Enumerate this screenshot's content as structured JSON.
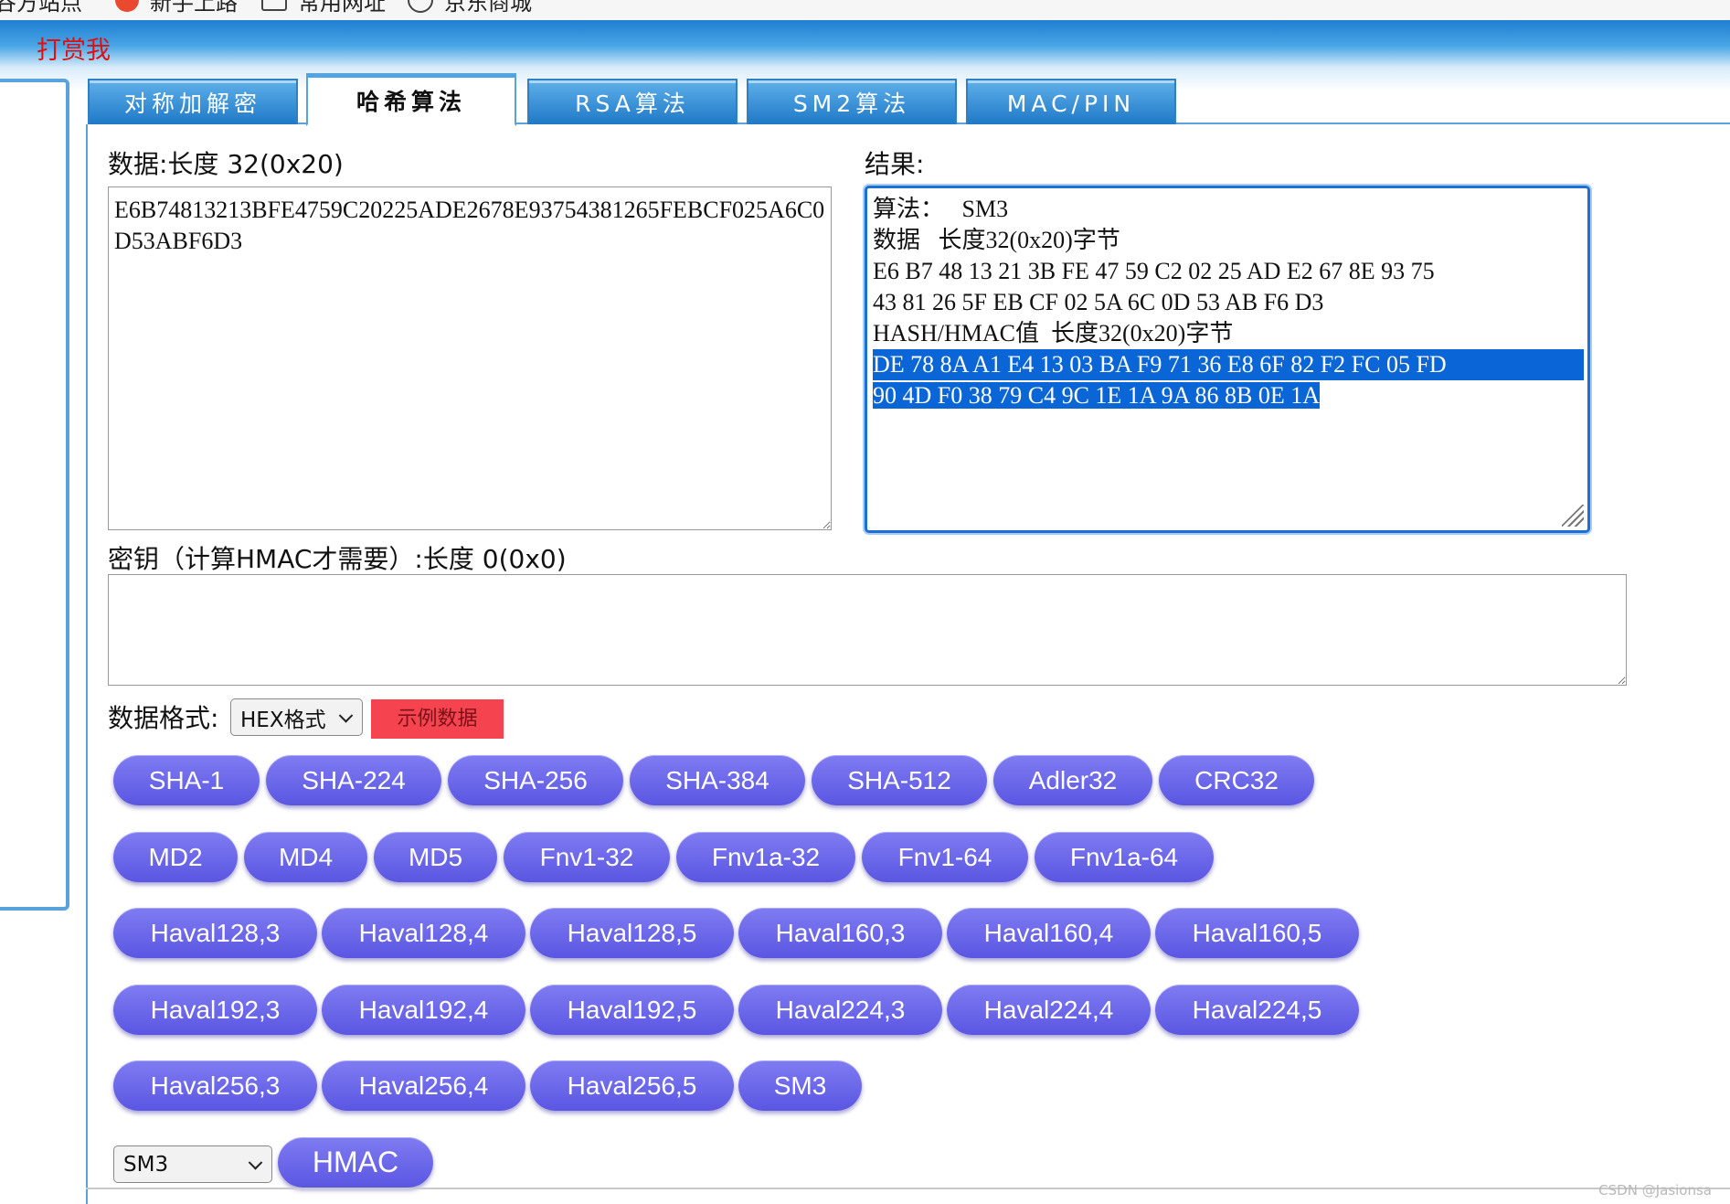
{
  "bookmarks": [
    {
      "label": "谷方站点",
      "icon": "none"
    },
    {
      "label": "新手上路",
      "icon": "firefox-icon"
    },
    {
      "label": "常用网址",
      "icon": "folder-icon"
    },
    {
      "label": "京东商城",
      "icon": "globe-icon"
    }
  ],
  "header": {
    "donate_link": "打赏我"
  },
  "tabs": [
    {
      "label": "对称加解密",
      "active": false
    },
    {
      "label": "哈希算法",
      "active": true
    },
    {
      "label": "RSA算法",
      "active": false
    },
    {
      "label": "SM2算法",
      "active": false
    },
    {
      "label": "MAC/PIN",
      "active": false
    }
  ],
  "data_section": {
    "label": "数据:长度 32(0x20)",
    "value": "E6B74813213BFE4759C20225ADE2678E93754381265FEBCF025A6C0D53ABF6D3"
  },
  "result_section": {
    "label": "结果:",
    "lines": [
      "算法：   SM3",
      "数据   长度32(0x20)字节",
      "E6 B7 48 13 21 3B FE 47 59 C2 02 25 AD E2 67 8E 93 75",
      "43 81 26 5F EB CF 02 5A 6C 0D 53 AB F6 D3",
      "HASH/HMAC值  长度32(0x20)字节",
      "DE 78 8A A1 E4 13 03 BA F9 71 36 E8 6F 82 F2 FC 05 FD",
      "90 4D F0 38 79 C4 9C 1E 1A 9A 86 8B 0E 1A"
    ]
  },
  "key_section": {
    "label": "密钥（计算HMAC才需要）:长度 0(0x0)",
    "value": ""
  },
  "format": {
    "label": "数据格式:",
    "selected": "HEX格式",
    "sample_button": "示例数据"
  },
  "hash_buttons": {
    "row1": [
      "SHA-1",
      "SHA-224",
      "SHA-256",
      "SHA-384",
      "SHA-512",
      "Adler32",
      "CRC32"
    ],
    "row2": [
      "MD2",
      "MD4",
      "MD5",
      "Fnv1-32",
      "Fnv1a-32",
      "Fnv1-64",
      "Fnv1a-64"
    ],
    "row3": [
      "Haval128,3",
      "Haval128,4",
      "Haval128,5",
      "Haval160,3",
      "Haval160,4",
      "Haval160,5"
    ],
    "row4": [
      "Haval192,3",
      "Haval192,4",
      "Haval192,5",
      "Haval224,3",
      "Haval224,4",
      "Haval224,5"
    ],
    "row5": [
      "Haval256,3",
      "Haval256,4",
      "Haval256,5",
      "SM3"
    ]
  },
  "hmac": {
    "selected_algorithm": "SM3",
    "button": "HMAC"
  },
  "watermark": "CSDN @Jasionsa"
}
